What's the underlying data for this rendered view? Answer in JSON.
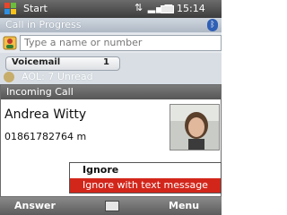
{
  "statusbar": {
    "title": "Start",
    "time": "15:14",
    "icons": [
      "windows-logo-icon",
      "data-connection-icon",
      "signal-icon",
      "battery-icon"
    ]
  },
  "call_header": {
    "label": "Call in Progress",
    "icon": "bluetooth-icon"
  },
  "search": {
    "placeholder": "Type a name or number",
    "icon": "contacts-icon"
  },
  "voicemail": {
    "label": "Voicemail",
    "count": "1"
  },
  "background_row": {
    "text": "AOL: 7 Unread"
  },
  "incoming_call": {
    "header": "Incoming Call",
    "caller_name": "Andrea Witty",
    "caller_number": "01861782764 m"
  },
  "context_menu": {
    "items": [
      {
        "label": "Ignore"
      },
      {
        "label": "Ignore with text message",
        "selected": true
      }
    ]
  },
  "softkeys": {
    "left": "Answer",
    "right": "Menu",
    "center_icon": "keyboard-icon"
  },
  "colors": {
    "menu_highlight": "#d3261b",
    "titlebar": "#4a4a4a",
    "bluetooth": "#2f5fb5"
  }
}
